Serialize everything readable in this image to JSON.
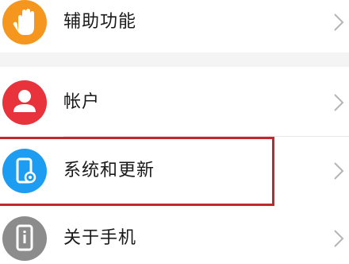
{
  "settings": {
    "items": [
      {
        "label": "辅助功能",
        "icon": "hand-icon",
        "color": "#f5961f"
      },
      {
        "label": "帐户",
        "icon": "user-icon",
        "color": "#e8323c"
      },
      {
        "label": "系统和更新",
        "icon": "phone-settings-icon",
        "color": "#1d9df2"
      },
      {
        "label": "关于手机",
        "icon": "phone-info-icon",
        "color": "#8c8c8c"
      }
    ],
    "highlighted_item": "系统和更新",
    "highlight_color": "#c1272d"
  }
}
